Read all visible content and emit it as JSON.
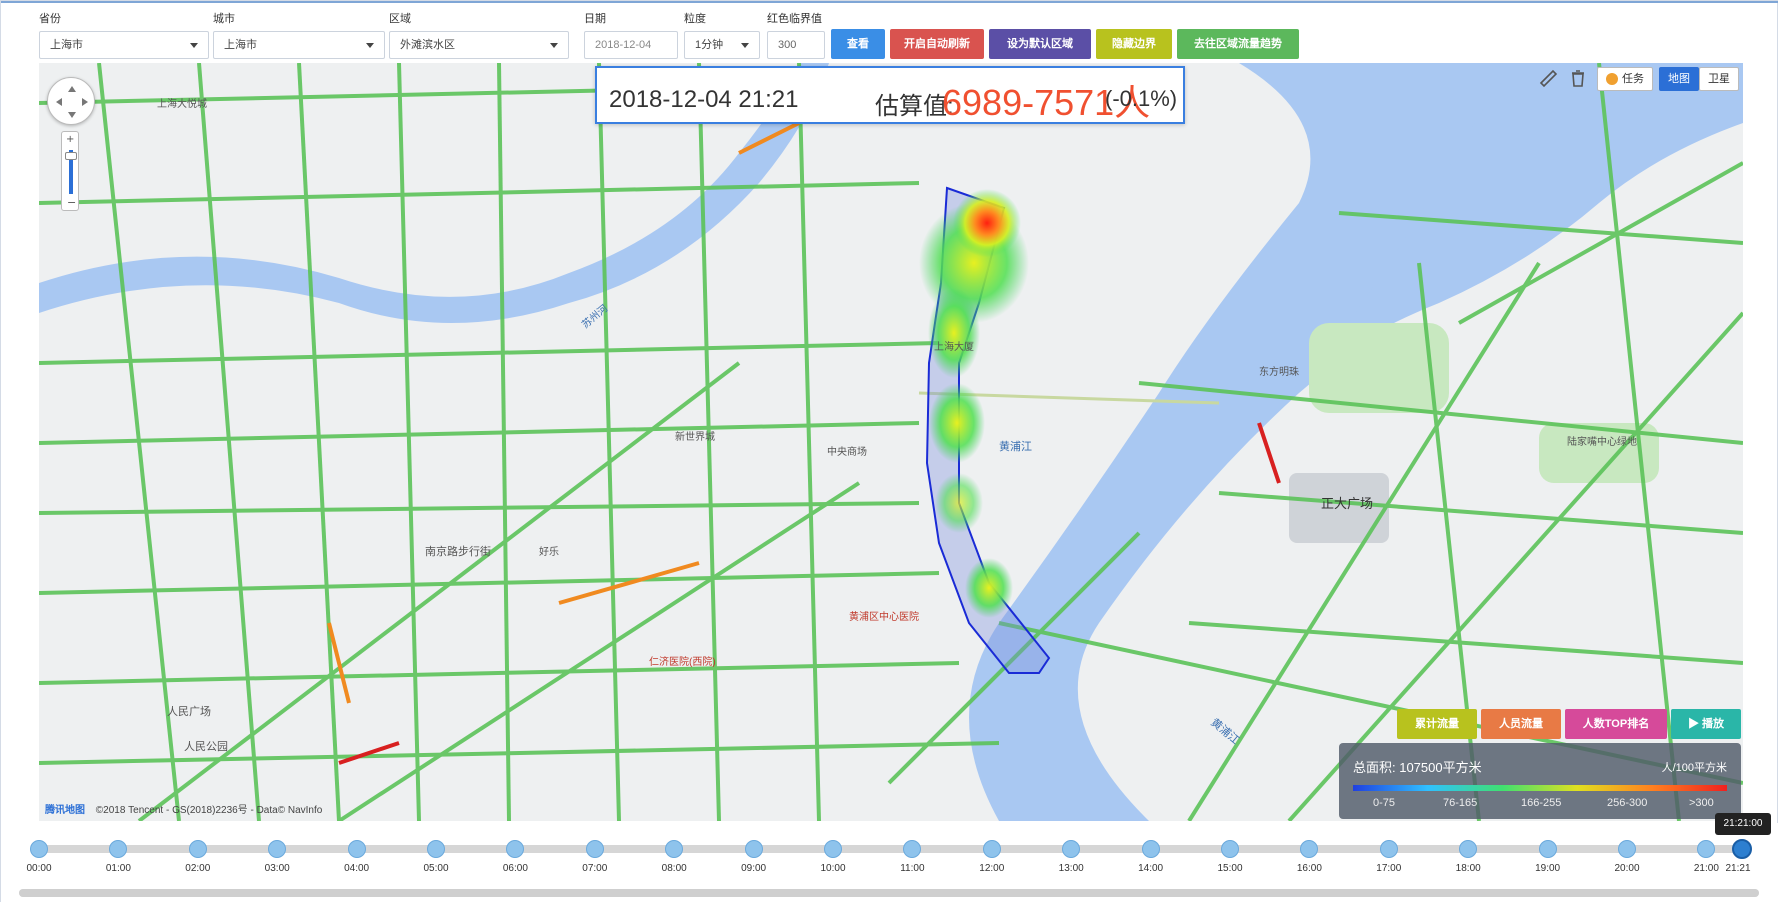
{
  "filters": {
    "province_label": "省份",
    "province_value": "上海市",
    "city_label": "城市",
    "city_value": "上海市",
    "district_label": "区域",
    "district_value": "外滩滨水区",
    "date_label": "日期",
    "date_value": "2018-12-04",
    "granularity_label": "粒度",
    "granularity_value": "1分钟",
    "threshold_label": "红色临界值",
    "threshold_value": "300"
  },
  "toolbar": {
    "view_label": "查看",
    "refresh_label": "开启自动刷新",
    "default_label": "设为默认区域",
    "hide_border_label": "隐藏边界",
    "trend_label": "去往区域流量趋势"
  },
  "info": {
    "datetime": "2018-12-04 21:21",
    "estimate_label": "估算值:",
    "value": "6989-7571人",
    "change": "(-0.1%)"
  },
  "map_controls": {
    "task_label": "任务",
    "map_label": "地图",
    "satellite_label": "卫星"
  },
  "map_labels": {
    "huangpu_river": "黄浦江",
    "suzhou_creek": "苏州河",
    "zhengda": "正大广场",
    "renmin_park": "人民公园",
    "renmin_square": "人民广场",
    "nanjing_road": "南京路步行街",
    "lujiazui": "陆家嘴中心绿地",
    "oriental_pearl": "东方明珠",
    "haoke": "好乐",
    "xinshijie": "新世界城",
    "zhongyang": "中央商场",
    "huangpu_hospital": "黄浦区中心医院",
    "renji": "仁济医院(西院)",
    "hongkou": "上海大悦城",
    "shanghai_mansion": "上海大厦"
  },
  "bottom_buttons": {
    "cumulative_label": "累计流量",
    "people_flow_label": "人员流量",
    "top_label": "人数TOP排名",
    "play_label": "播放"
  },
  "legend": {
    "area_label": "总面积: 107500平方米",
    "unit_label": "人/100平方米",
    "ranges": [
      "0-75",
      "76-165",
      "166-255",
      "256-300",
      ">300"
    ]
  },
  "copyright": "©2018 Tencent - GS(2018)2236号 - Data© NavInfo",
  "brand": "腾讯地图",
  "timeline": {
    "labels": [
      "00:00",
      "01:00",
      "02:00",
      "03:00",
      "04:00",
      "05:00",
      "06:00",
      "07:00",
      "08:00",
      "09:00",
      "10:00",
      "11:00",
      "12:00",
      "13:00",
      "14:00",
      "15:00",
      "16:00",
      "17:00",
      "18:00",
      "19:00",
      "20:00",
      "21:00",
      "21:21"
    ],
    "current": "21:21:00"
  },
  "colors": {
    "view_btn": "#3a8ee6",
    "refresh_btn": "#d9534f",
    "default_btn": "#5b4fa6",
    "hide_btn": "#b8c21e",
    "trend_btn": "#5cb85c",
    "cumulative_btn": "#b8c21e",
    "flow_btn": "#e87a45",
    "top_btn": "#d64a9a",
    "play_btn": "#2ab6a8"
  }
}
